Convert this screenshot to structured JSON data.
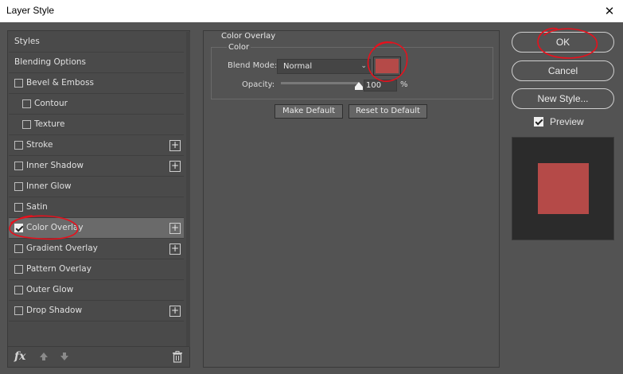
{
  "window": {
    "title": "Layer Style",
    "close_glyph": "✕"
  },
  "styles_list": {
    "items": [
      {
        "label": "Styles",
        "type": "header"
      },
      {
        "label": "Blending Options",
        "type": "header"
      },
      {
        "label": "Bevel & Emboss",
        "checked": false,
        "indent": 0,
        "has_plus": false
      },
      {
        "label": "Contour",
        "checked": false,
        "indent": 1,
        "has_plus": false
      },
      {
        "label": "Texture",
        "checked": false,
        "indent": 1,
        "has_plus": false
      },
      {
        "label": "Stroke",
        "checked": false,
        "indent": 0,
        "has_plus": true
      },
      {
        "label": "Inner Shadow",
        "checked": false,
        "indent": 0,
        "has_plus": true
      },
      {
        "label": "Inner Glow",
        "checked": false,
        "indent": 0,
        "has_plus": false
      },
      {
        "label": "Satin",
        "checked": false,
        "indent": 0,
        "has_plus": false
      },
      {
        "label": "Color Overlay",
        "checked": true,
        "indent": 0,
        "has_plus": true,
        "active": true
      },
      {
        "label": "Gradient Overlay",
        "checked": false,
        "indent": 0,
        "has_plus": true
      },
      {
        "label": "Pattern Overlay",
        "checked": false,
        "indent": 0,
        "has_plus": false
      },
      {
        "label": "Outer Glow",
        "checked": false,
        "indent": 0,
        "has_plus": false
      },
      {
        "label": "Drop Shadow",
        "checked": false,
        "indent": 0,
        "has_plus": true
      }
    ],
    "plus_glyph": "+",
    "footer": {
      "fx_label": "fx",
      "icons": [
        "move-up-icon",
        "move-down-icon",
        "trash-icon"
      ]
    }
  },
  "color_overlay": {
    "group_title": "Color Overlay",
    "subgroup_title": "Color",
    "blend_mode_label": "Blend Mode:",
    "blend_mode_value": "Normal",
    "overlay_color": "#b54a48",
    "opacity_label": "Opacity:",
    "opacity_value": "100",
    "opacity_fraction": 1.0,
    "opacity_unit": "%",
    "make_default_label": "Make Default",
    "reset_default_label": "Reset to Default"
  },
  "buttons": {
    "ok": "OK",
    "cancel": "Cancel",
    "new_style": "New Style..."
  },
  "preview": {
    "label": "Preview",
    "checked": true,
    "swatch_color": "#b54a48"
  },
  "annotations": {
    "color": "#e8101c"
  }
}
